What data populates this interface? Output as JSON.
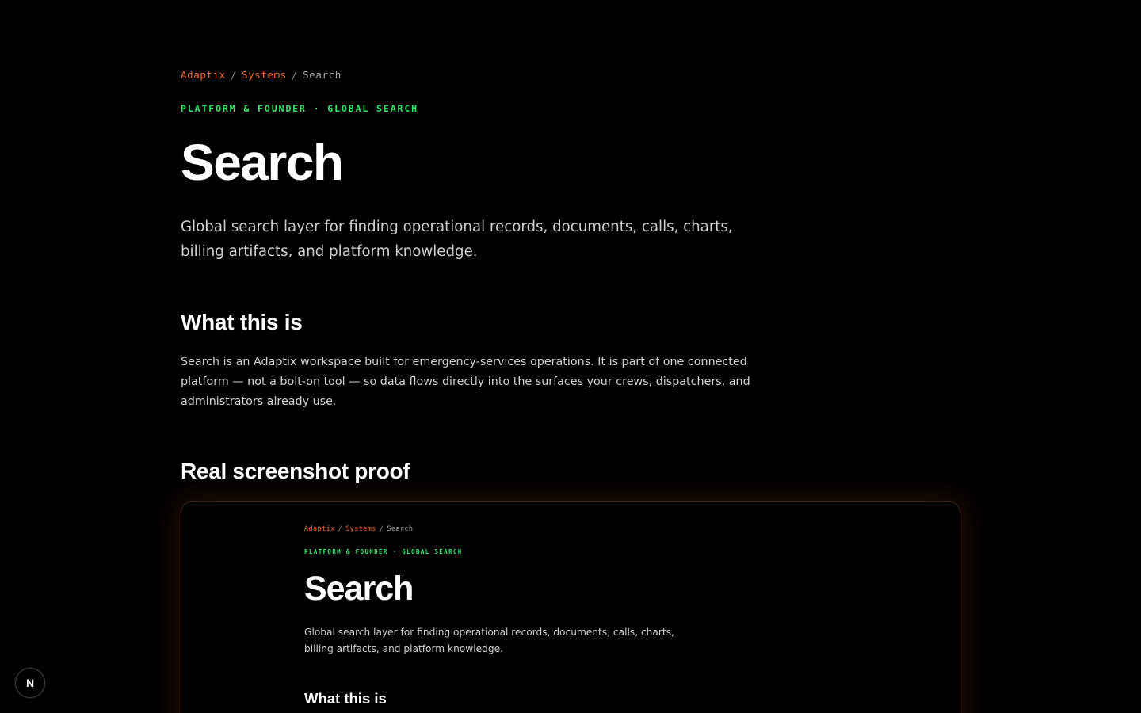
{
  "breadcrumb": {
    "items": [
      "Adaptix",
      "Systems"
    ],
    "separator": "/",
    "current": "Search"
  },
  "eyebrow": "PLATFORM & FOUNDER · GLOBAL SEARCH",
  "title": "Search",
  "lede": "Global search layer for finding operational records, documents, calls, charts, billing artifacts, and platform knowledge.",
  "sections": {
    "what": {
      "heading": "What this is",
      "body": "Search is an Adaptix workspace built for emergency-services operations. It is part of one connected platform — not a bolt-on tool — so data flows directly into the surfaces your crews, dispatchers, and administrators already use."
    },
    "proof": {
      "heading": "Real screenshot proof"
    }
  },
  "screenshot": {
    "breadcrumb": {
      "items": [
        "Adaptix",
        "Systems"
      ],
      "separator": "/",
      "current": "Search"
    },
    "eyebrow": "PLATFORM & FOUNDER · GLOBAL SEARCH",
    "title": "Search",
    "lede": "Global search layer for finding operational records, documents, calls, charts, billing artifacts, and platform knowledge.",
    "heading": "What this is"
  },
  "dev_badge": {
    "label": "N",
    "icon": "nextjs-logo-icon"
  },
  "colors": {
    "background": "#000000",
    "accent_orange": "#f26b2a",
    "accent_green": "#2ee866",
    "text_primary": "#ffffff",
    "text_muted": "#cfcfcf"
  }
}
